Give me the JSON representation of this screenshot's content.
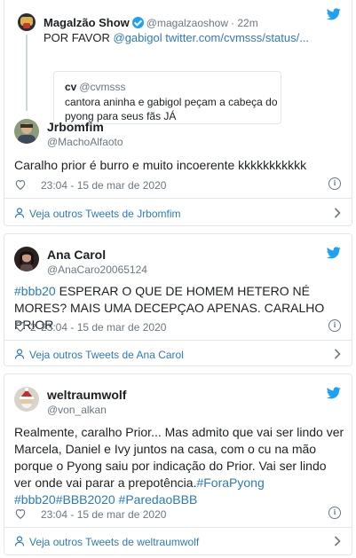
{
  "tweets": [
    {
      "context": {
        "name": "Magalzão Show",
        "handle": "@magalzaoshow",
        "time": "· 22m",
        "text_prefix": "POR FAVOR ",
        "text_link": "@gabigol twitter.com/cvmsss/status/...",
        "quote": {
          "name": "cv",
          "handle": "@cvmsss",
          "text": "cantora aninha e gabigol peçam a cabeça do pyong para seus fãs JÁ"
        }
      },
      "name": "Jrbomfim",
      "handle": "@MachoAlfaoto",
      "text": "Caralho prior é burro e muito incoerente kkkkkkkkkkk",
      "likes": "",
      "time": "23:04 - 15 de mar de 2020",
      "more_label": "Veja outros Tweets de Jrbomfim"
    },
    {
      "name": "Ana Carol",
      "handle": "@AnaCaro20065124",
      "text_hashtag": "#bbb20",
      "text": " ESPERAR O QUE DE HOMEM HETERO NÉ MORES? MAIS UMA DECEPÇAO APENAS. CARALHO PRIOR",
      "likes": "2",
      "time": "23:04 - 15 de mar de 2020",
      "more_label": "Veja outros Tweets de Ana Carol"
    },
    {
      "name": "weltraumwolf",
      "handle": "@von_alkan",
      "text": "Realmente, caralho Prior... Mas admito que vai ser lindo ver Marcela, Daniel e Ivy juntos na casa, com o cu na mão porque o Pyong saiu por indicação do Prior. Vai ser lindo ver onde vai parar a prepotência.",
      "hashtags": "#ForaPyong #bbb20#BBB2020 #ParedaoBBB",
      "likes": "",
      "time": "23:04 - 15 de mar de 2020",
      "more_label": "Veja outros Tweets de weltraumwolf"
    }
  ],
  "icons": {
    "brand": "twitter-bird-icon",
    "like": "heart-icon",
    "info": "info-icon",
    "profile": "person-icon",
    "chevron": "chevron-right-icon"
  },
  "colors": {
    "link": "#2b7bb9",
    "twitter_blue": "#1da1f2",
    "muted": "#697882",
    "border": "#e1e8ed"
  }
}
